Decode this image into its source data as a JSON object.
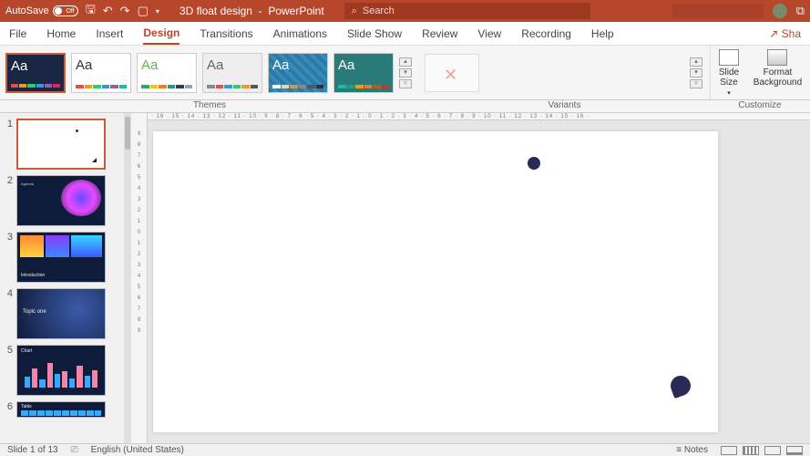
{
  "titlebar": {
    "autosave_label": "AutoSave",
    "autosave_state": "Off",
    "doc_title": "3D float design",
    "app_name": "PowerPoint",
    "search_placeholder": "Search"
  },
  "tabs": {
    "items": [
      "File",
      "Home",
      "Insert",
      "Design",
      "Transitions",
      "Animations",
      "Slide Show",
      "Review",
      "View",
      "Recording",
      "Help"
    ],
    "active": "Design",
    "share": "Sha"
  },
  "ribbon": {
    "themes_label": "Themes",
    "variants_label": "Variants",
    "customize_label": "Customize",
    "slide_size": "Slide Size",
    "format_bg": "Format Background"
  },
  "thumbs": {
    "count": 13,
    "visible": [
      1,
      2,
      3,
      4,
      5,
      6
    ],
    "slide2_title": "Agenda",
    "slide3_title": "Introduction",
    "slide4_title": "Topic one",
    "slide5_title": "Chart",
    "slide6_title": "Table"
  },
  "status": {
    "slide_pos": "Slide 1 of 13",
    "language": "English (United States)",
    "notes": "Notes"
  },
  "colors": {
    "accent": "#b7472a",
    "dark": "#1a2744"
  }
}
